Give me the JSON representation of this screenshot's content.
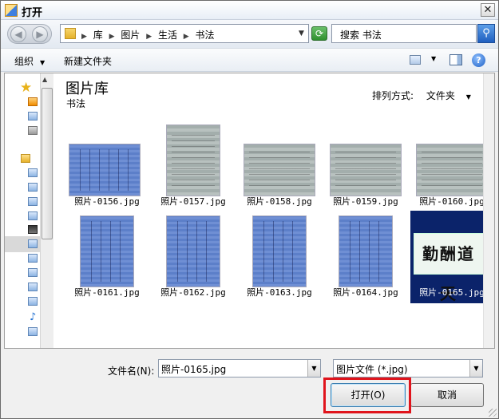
{
  "window": {
    "title": "打开"
  },
  "address": {
    "breadcrumbs": [
      "库",
      "图片",
      "生活",
      "书法"
    ]
  },
  "search": {
    "placeholder": "搜索 书法"
  },
  "toolbar": {
    "organize": "组织",
    "new_folder": "新建文件夹"
  },
  "library": {
    "title": "图片库",
    "subtitle": "书法",
    "arrange_label": "排列方式:",
    "arrange_value": "文件夹"
  },
  "files": [
    {
      "name": "照片-0156.jpg"
    },
    {
      "name": "照片-0157.jpg"
    },
    {
      "name": "照片-0158.jpg"
    },
    {
      "name": "照片-0159.jpg"
    },
    {
      "name": "照片-0160.jpg"
    },
    {
      "name": "照片-0161.jpg"
    },
    {
      "name": "照片-0162.jpg"
    },
    {
      "name": "照片-0163.jpg"
    },
    {
      "name": "照片-0164.jpg"
    },
    {
      "name": "照片-0165.jpg",
      "selected": true,
      "calligraphy_text": "勤酬道天"
    }
  ],
  "footer": {
    "filename_label": "文件名(N):",
    "filename_value": "照片-0165.jpg",
    "filetype_value": "图片文件 (*.jpg)",
    "open_label": "打开(O)",
    "cancel_label": "取消"
  },
  "colors": {
    "selection": "#0b236a",
    "highlight_border": "#e0141c"
  }
}
